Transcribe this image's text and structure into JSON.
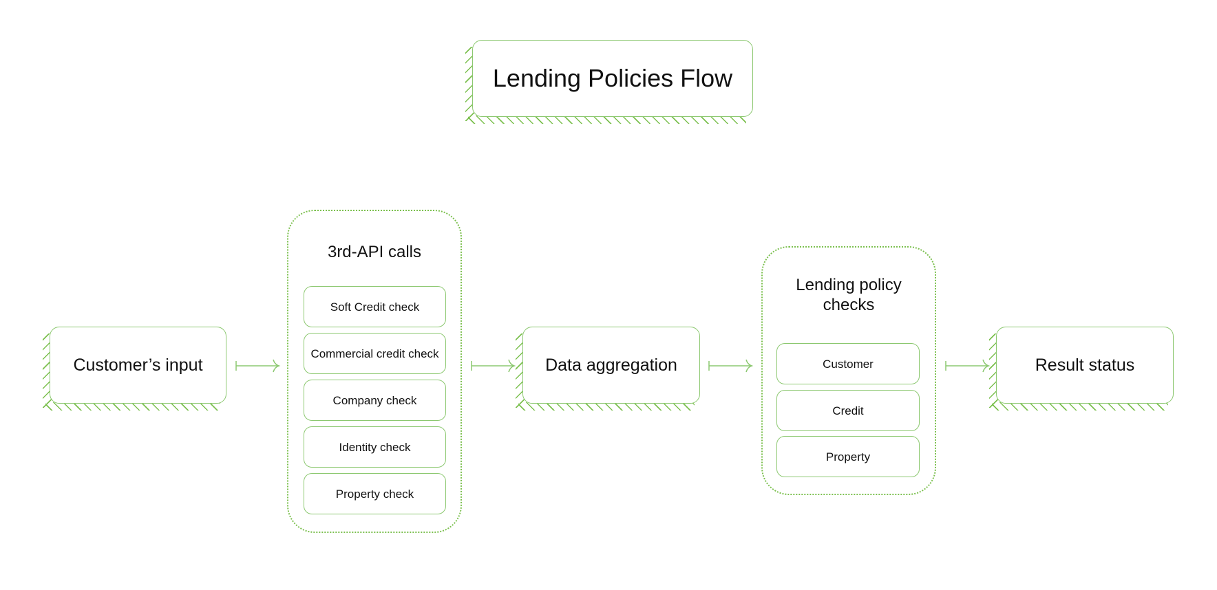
{
  "title": "Lending Policies Flow",
  "nodes": {
    "customer_input": "Customer’s input",
    "data_aggregation": "Data aggregation",
    "result_status": "Result status"
  },
  "groups": {
    "third_party_api": {
      "title": "3rd-API calls",
      "items": [
        "Soft Credit check",
        "Commercial credit check",
        "Company check",
        "Identity check",
        "Property check"
      ]
    },
    "lending_policy": {
      "title": "Lending policy checks",
      "items": [
        "Customer",
        "Credit",
        "Property"
      ]
    }
  },
  "colors": {
    "accent": "#7cc04f",
    "border": "#8cc870",
    "text": "#111111"
  },
  "edges": [
    {
      "from": "Customer’s input",
      "to": "3rd-API calls"
    },
    {
      "from": "3rd-API calls",
      "to": "Data aggregation"
    },
    {
      "from": "Data aggregation",
      "to": "Lending policy checks"
    },
    {
      "from": "Lending policy checks",
      "to": "Result status"
    }
  ]
}
